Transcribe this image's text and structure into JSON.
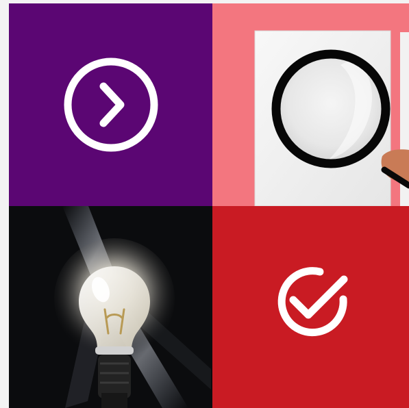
{
  "tiles": [
    {
      "name": "next-tile",
      "icon": "chevron-right-circle-icon",
      "background": "#5b0673"
    },
    {
      "name": "search-tile",
      "icon": "magnifying-glass-icon",
      "background": "#f3767f"
    },
    {
      "name": "idea-tile",
      "icon": "lightbulb-icon",
      "background": "#0b0c0e"
    },
    {
      "name": "complete-tile",
      "icon": "check-circle-icon",
      "background": "#c91b23"
    }
  ]
}
